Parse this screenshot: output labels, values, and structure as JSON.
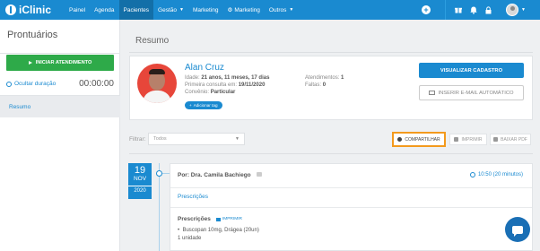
{
  "nav": {
    "brand": "iClinic",
    "items": [
      {
        "label": "Painel"
      },
      {
        "label": "Agenda"
      },
      {
        "label": "Pacientes"
      },
      {
        "label": "Gestão"
      },
      {
        "label": "Marketing"
      },
      {
        "label": "Marketing"
      },
      {
        "label": "Outros"
      }
    ],
    "icons": [
      "plus-circle-icon",
      "gift-icon",
      "bell-icon",
      "lock-icon"
    ]
  },
  "sidebar": {
    "title": "Prontuários",
    "start_button": "INICIAR ATENDIMENTO",
    "hide_duration": "Ocultar duração",
    "timer": "00:00:00",
    "items": [
      {
        "label": "Resumo"
      }
    ]
  },
  "main": {
    "title": "Resumo",
    "patient": {
      "name": "Alan Cruz",
      "age_label": "Idade:",
      "age_value": "21 anos, 11 meses, 17 dias",
      "first_visit_label": "Primeira consulta em:",
      "first_visit_value": "19/11/2020",
      "plan_label": "Convênio:",
      "plan_value": "Particular",
      "add_tag": "Adicionar tag",
      "appointments_label": "Atendimentos:",
      "appointments_value": "1",
      "absences_label": "Faltas:",
      "absences_value": "0",
      "view_button": "VISUALIZAR CADASTRO",
      "email_button": "INSERIR E-MAIL AUTOMÁTICO"
    },
    "filter": {
      "label": "Filtrar:",
      "value": "Todos"
    },
    "actions": {
      "share": "COMPARTILHAR",
      "print": "IMPRIMIR",
      "pdf": "BAIXAR PDF"
    },
    "entry": {
      "day": "19",
      "month": "NOV",
      "year": "2020",
      "doctor": "Por: Dra. Camila Bachiego",
      "time": "10:50 (20 minutos)",
      "link": "Prescrições",
      "section_title": "Prescrições",
      "print": "IMPRIMIR",
      "items": [
        "Buscopan 10mg, Drágea (20un)",
        "1 unidade"
      ]
    }
  },
  "colors": {
    "primary": "#1a8ad0",
    "success": "#2eaa49",
    "highlight": "#f39a1d"
  }
}
